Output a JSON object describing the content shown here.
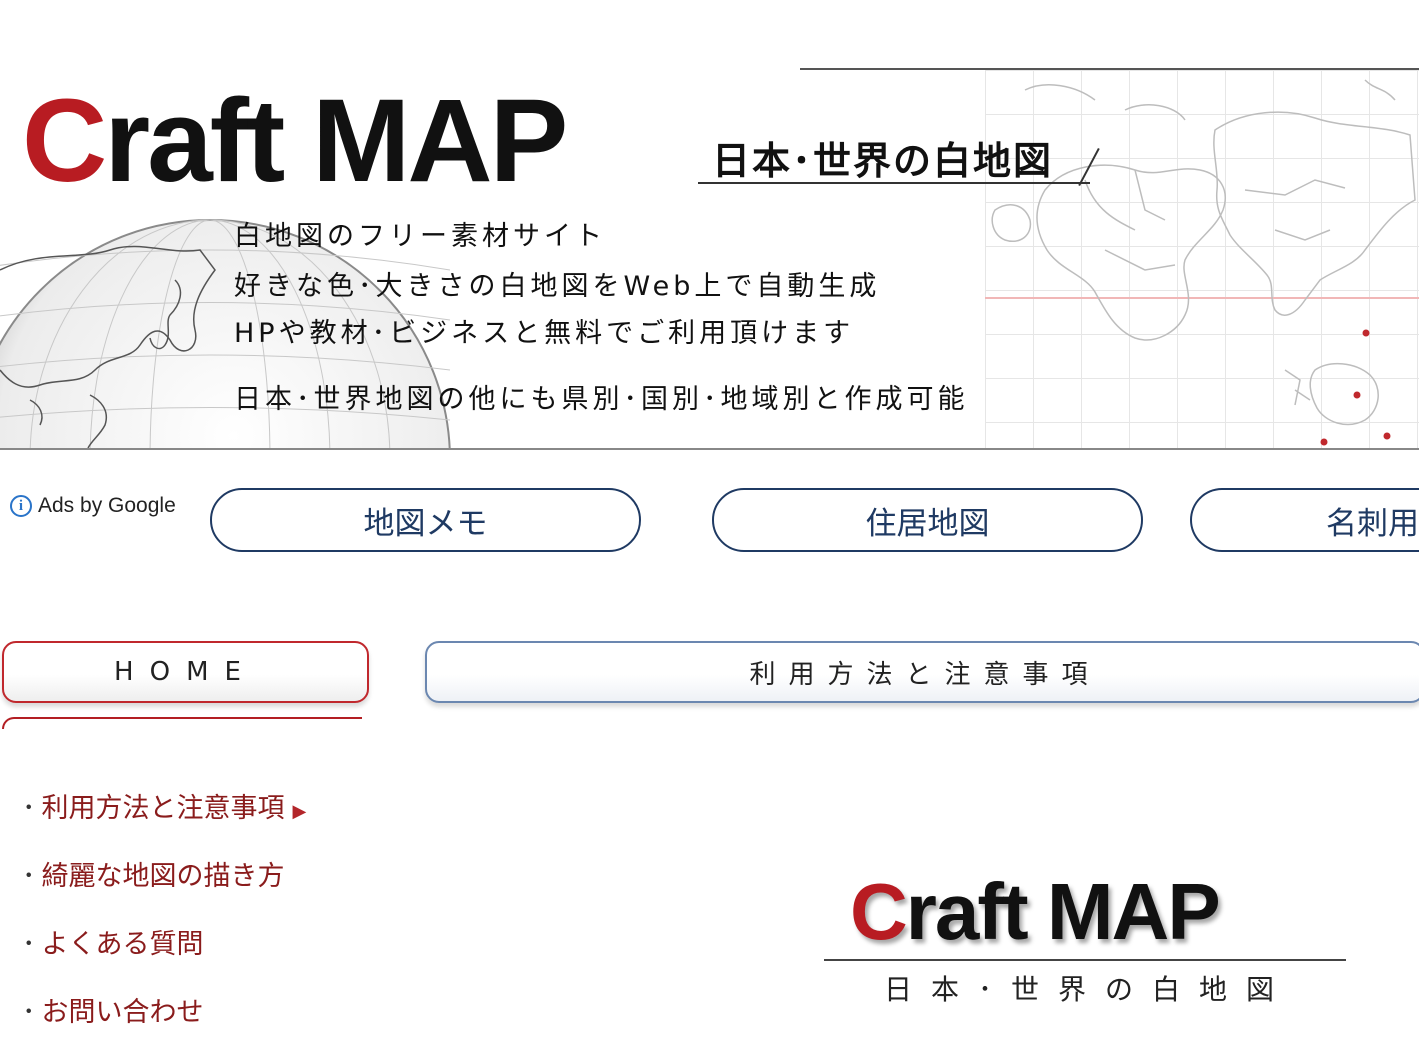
{
  "header": {
    "logo": {
      "initial": "C",
      "rest": "raft MAP"
    },
    "subtitle": "日本･世界の白地図",
    "taglines": [
      "白地図のフリー素材サイト",
      "好きな色･大きさの白地図をWeb上で自動生成",
      "HPや教材･ビジネスと無料でご利用頂けます",
      "日本･世界地図の他にも県別･国別･地域別と作成可能"
    ]
  },
  "ads": {
    "label": "Ads by Google",
    "links": [
      "地図メモ",
      "住居地図",
      "名刺用"
    ]
  },
  "nav": {
    "home": "HOME",
    "usage": "利用方法と注意事項"
  },
  "sidebar": {
    "items": [
      "利用方法と注意事項",
      "綺麗な地図の描き方",
      "よくある質問",
      "お問い合わせ"
    ]
  },
  "footer_logo": {
    "initial": "C",
    "rest": "raft MAP",
    "subtitle": "日本･世界の白地図"
  },
  "colors": {
    "brand_red": "#b81c22",
    "link_red": "#8a1c1c",
    "ad_border": "#1f3a63"
  },
  "icons": [
    "info-icon",
    "globe-graphic",
    "world-map-graphic",
    "arrow-right-icon"
  ]
}
